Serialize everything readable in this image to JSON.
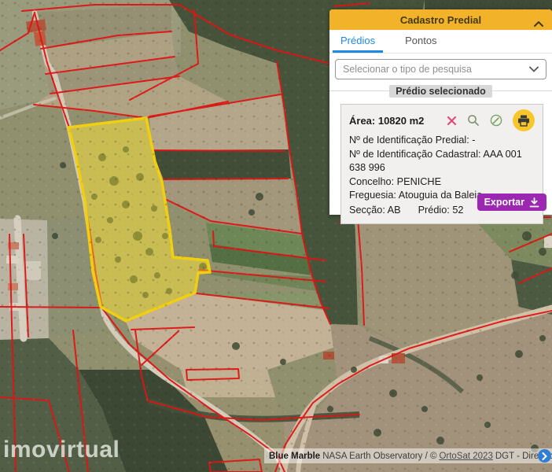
{
  "header": {
    "title": "Cadastro Predial"
  },
  "tabs": {
    "predios": "Prédios",
    "pontos": "Pontos"
  },
  "search": {
    "placeholder": "Selecionar o tipo de pesquisa"
  },
  "selected_section_label": "Prédio selecionado",
  "parcel_info": {
    "area": "Área: 10820 m2",
    "line1": "Nº de Identificação Predial: -",
    "line2": "Nº de Identificação Cadastral: AAA 001 638 996",
    "line3": "Concelho: PENICHE",
    "line4": "Freguesia: Atouguia da Baleia",
    "seccao": "Secção: AB",
    "predio": "Prédio: 52"
  },
  "export": {
    "label": "Exportar"
  },
  "watermark": "imovirtual",
  "attribution": {
    "source_bold": "Blue Marble",
    "source_rest": "NASA Earth Observatory / ©",
    "link": "OrtoSat 2023",
    "rest": "DGT - Direção-Geral do Território"
  },
  "icons": {
    "deselect": "x-icon",
    "zoom": "magnifier-icon",
    "edit": "pencil-icon",
    "print": "printer-icon",
    "export": "download-icon",
    "collapse": "chevron-up-icon",
    "select": "chevron-down-icon",
    "attribution_toggle": "chevron-right-icon"
  },
  "colors": {
    "panel_header": "#f2b32a",
    "active_tab": "#1e88e5",
    "export_button": "#9c27b0",
    "boundary_red": "#e11414",
    "selected_parcel_yellow": "#f2cf0e",
    "print_circle": "#f6c62b",
    "attribution_toggle_blue": "#2e7ed6"
  },
  "selected_parcel": {
    "area_m2": 10820,
    "seccao": "AB",
    "predio": 52
  }
}
